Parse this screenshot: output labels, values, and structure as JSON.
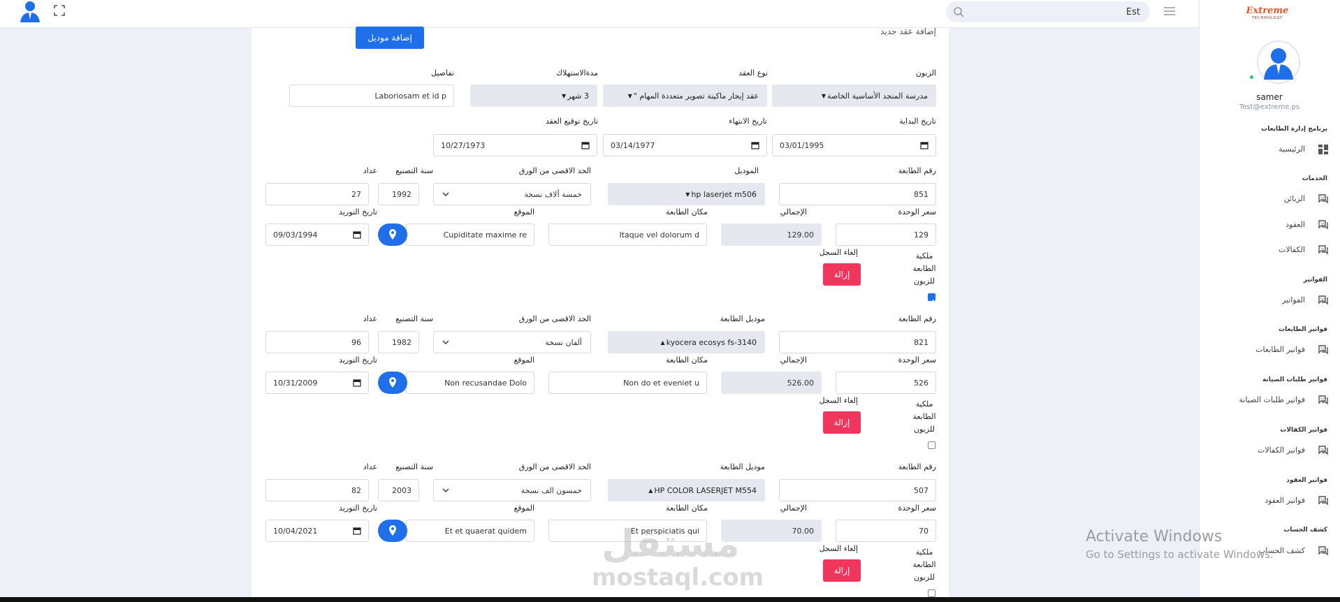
{
  "header": {
    "search": {
      "value": "Est"
    }
  },
  "sidebar": {
    "brand": {
      "name": "Extreme",
      "tagline": "TECHNOLOGY"
    },
    "user": {
      "name": "samer",
      "email": "Test@extreme.ps"
    },
    "sections": [
      {
        "title": "برنامج إدارة الطابعات",
        "item": "الرئيسية"
      },
      {
        "title": "الخدمات",
        "items": [
          "الزبائن",
          "العقود",
          "الكفالات"
        ]
      },
      {
        "title": "الفواتير",
        "item": "الفواتير"
      },
      {
        "title": "فواتير الطابعات",
        "item": "فواتير الطابعات"
      },
      {
        "title": "فواتير طلبات الصيانة",
        "item": "فواتير طلبات الصيانة"
      },
      {
        "title": "فواتير الكفالات",
        "item": "فواتير الكفالات"
      },
      {
        "title": "فواتير العقود",
        "item": "فواتير العقود"
      },
      {
        "title": "كشف الحساب",
        "item": "كشف الحساب"
      }
    ]
  },
  "page": {
    "title": "إضافة عقد جديد",
    "add_model_label": "إضافة موديل",
    "contract": {
      "labels": {
        "customer": "الزبون",
        "contract_type": "نوع العقد",
        "consumption_period": "مدةالاستهلاك",
        "details": "تفاصيل",
        "start_date": "تاريخ البداية",
        "end_date": "تاريخ الانتهاء",
        "sign_date": "تاريخ توقيع العقد"
      },
      "customer": "مدرسة المنجد الأساسية الخاصة",
      "contract_type": "عقد إيجار ماكينة تصوير متعددة المهام \"",
      "consumption_period": "3 شهر",
      "details": "Laboriosam et id p",
      "start_date": "03/01/1995",
      "end_date": "03/14/1977",
      "sign_date": "10/27/1973"
    },
    "printer_labels": {
      "printer_number": "رقم الطابعة",
      "model": "الموديل",
      "printer_model": "موديل الطابعة",
      "max_paper": "الحد الاقصى من الورق",
      "manufacture_year": "سنة التصنيع",
      "counter": "عداد",
      "unit_price": "سعر الوحدة",
      "total": "الإجمالي",
      "printer_place": "مكان الطابعة",
      "location": "الموقع",
      "supply_date": "تاريخ التوريد",
      "customer_owned": "ملكية الطابعة للزبون",
      "cancel_record": "إلغاء السجل",
      "remove": "إزالة"
    },
    "printers": [
      {
        "model_label": "الموديل",
        "printer_number": "851",
        "model": "hp laserjet m506",
        "max_paper": "خمسة ألاف نسخة",
        "manufacture_year": "1992",
        "counter": "27",
        "unit_price": "129",
        "total": "129.00",
        "printer_place": "Itaque vel dolorum d",
        "location": "Cupiditate maxime re",
        "supply_date": "09/03/1994",
        "customer_owned": true
      },
      {
        "model_label": "موديل الطابعة",
        "printer_number": "821",
        "model": "kyocera ecosys fs-3140",
        "max_paper": "ألفان نسخة",
        "manufacture_year": "1982",
        "counter": "96",
        "unit_price": "526",
        "total": "526.00",
        "printer_place": "Non do et eveniet u",
        "location": "Non recusandae Dolo",
        "supply_date": "10/31/2009",
        "customer_owned": false
      },
      {
        "model_label": "موديل الطابعة",
        "printer_number": "507",
        "model": "HP COLOR LASERJET M554",
        "max_paper": "خمسون الف نسخة",
        "manufacture_year": "2003",
        "counter": "82",
        "unit_price": "70",
        "total": "70.00",
        "printer_place": "Et perspiciatis qui",
        "location": "Et et quaerat quidem",
        "supply_date": "10/04/2021",
        "customer_owned": false
      }
    ]
  },
  "watermark": {
    "line1": "مستقل",
    "line2": "mostaql.com"
  },
  "os_notice": {
    "line1": "Activate Windows",
    "line2": "Go to Settings to activate Windows."
  }
}
